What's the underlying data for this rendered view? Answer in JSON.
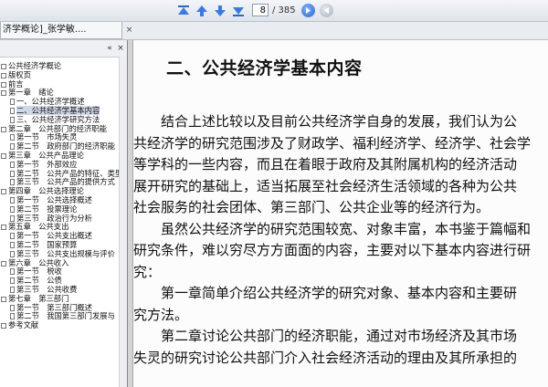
{
  "toolbar": {
    "page_number": "8",
    "page_total": "/ 385"
  },
  "tab": {
    "title": "济学概论]_张学敏....",
    "close_glyph": "×"
  },
  "sidebar": {
    "items": [
      {
        "label": "公共经济学概论",
        "indent": 0,
        "icon": "box"
      },
      {
        "label": "版权页",
        "indent": 0,
        "icon": "box"
      },
      {
        "label": "前言",
        "indent": 0,
        "icon": "box"
      },
      {
        "label": "第一章　绪论",
        "indent": 0,
        "icon": "box"
      },
      {
        "label": "一、公共经济学概述",
        "indent": 1,
        "icon": "page"
      },
      {
        "label": "二、公共经济学基本内容",
        "indent": 1,
        "icon": "page",
        "selected": true
      },
      {
        "label": "三、公共经济学研究方法",
        "indent": 1,
        "icon": "page"
      },
      {
        "label": "第二章　公共部门的经济职能",
        "indent": 0,
        "icon": "box"
      },
      {
        "label": "第一节　市场失灵",
        "indent": 1,
        "icon": "page"
      },
      {
        "label": "第二节　政府部门的经济职能",
        "indent": 1,
        "icon": "page"
      },
      {
        "label": "第三章　公共产品理论",
        "indent": 0,
        "icon": "box"
      },
      {
        "label": "第一节　外部效应",
        "indent": 1,
        "icon": "page"
      },
      {
        "label": "第二节　公共产品的特征、类型",
        "indent": 1,
        "icon": "page"
      },
      {
        "label": "第三节　公共产品的提供方式",
        "indent": 1,
        "icon": "page"
      },
      {
        "label": "第四章　公共选择理论",
        "indent": 0,
        "icon": "box"
      },
      {
        "label": "第一节　公共选择概述",
        "indent": 1,
        "icon": "page"
      },
      {
        "label": "第二节　投票理论",
        "indent": 1,
        "icon": "page"
      },
      {
        "label": "第三节　政治行为分析",
        "indent": 1,
        "icon": "page"
      },
      {
        "label": "第五章　公共支出",
        "indent": 0,
        "icon": "box"
      },
      {
        "label": "第一节　公共支出概述",
        "indent": 1,
        "icon": "page"
      },
      {
        "label": "第二节　国家预算",
        "indent": 1,
        "icon": "page"
      },
      {
        "label": "第三节　公共支出规模与评价",
        "indent": 1,
        "icon": "page"
      },
      {
        "label": "第六章　公共收入",
        "indent": 0,
        "icon": "box"
      },
      {
        "label": "第一节　税收",
        "indent": 1,
        "icon": "page"
      },
      {
        "label": "第二节　公债",
        "indent": 1,
        "icon": "page"
      },
      {
        "label": "第三节　公共收费",
        "indent": 1,
        "icon": "page"
      },
      {
        "label": "第七章　第三部门",
        "indent": 0,
        "icon": "box"
      },
      {
        "label": "第一节　第三部门概述",
        "indent": 1,
        "icon": "page"
      },
      {
        "label": "第二节　我国第三部门发展与",
        "indent": 1,
        "icon": "page"
      },
      {
        "label": "参考文献",
        "indent": 0,
        "icon": "box"
      }
    ]
  },
  "document": {
    "title": "二、公共经济学基本内容",
    "lines": [
      "　　结合上述比较以及目前公共经济学自身的发展，我们认为公",
      "共经济学的研究范围涉及了财政学、福利经济学、经济学、社会学",
      "等学科的一些内容，而且在着眼于政府及其附属机构的经济活动",
      "展开研究的基础上，适当拓展至社会经济生活领域的各种为公共",
      "社会服务的社会团体、第三部门、公共企业等的经济行为。",
      "　　虽然公共经济学的研究范围较宽、对象丰富，本书鉴于篇幅和",
      "研究条件，难以穷尽方方面面的内容，主要对以下基本内容进行研",
      "究：",
      "　　第一章简单介绍公共经济学的研究对象、基本内容和主要研",
      "究方法。",
      "　　第二章讨论公共部门的经济职能，通过对市场经济及其市场",
      "失灵的研究讨论公共部门介入社会经济活动的理由及其所承担的"
    ]
  }
}
